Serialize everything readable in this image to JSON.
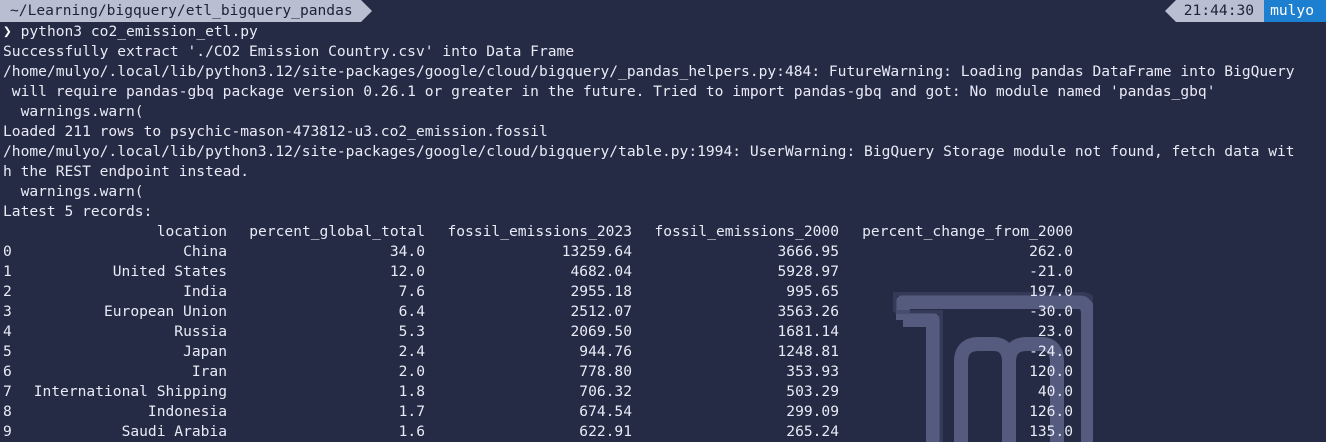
{
  "prompt": {
    "path": "~/Learning/bigquery/etl_bigquery_pandas",
    "time": "21:44:30",
    "user": "mulyo",
    "symbol": "❯",
    "command": "python3 co2_emission_etl.py"
  },
  "output": {
    "lines": [
      "Successfully extract './CO2 Emission Country.csv' into Data Frame",
      "/home/mulyo/.local/lib/python3.12/site-packages/google/cloud/bigquery/_pandas_helpers.py:484: FutureWarning: Loading pandas DataFrame into BigQuery",
      " will require pandas-gbq package version 0.26.1 or greater in the future. Tried to import pandas-gbq and got: No module named 'pandas_gbq'",
      "  warnings.warn(",
      "Loaded 211 rows to psychic-mason-473812-u3.co2_emission.fossil",
      "/home/mulyo/.local/lib/python3.12/site-packages/google/cloud/bigquery/table.py:1994: UserWarning: BigQuery Storage module not found, fetch data wit",
      "h the REST endpoint instead.",
      "  warnings.warn(",
      "Latest 5 records:"
    ]
  },
  "table": {
    "headers": [
      "location",
      "percent_global_total",
      "fossil_emissions_2023",
      "fossil_emissions_2000",
      "percent_change_from_2000"
    ],
    "rows": [
      [
        "0",
        "China",
        "34.0",
        "13259.64",
        "3666.95",
        "262.0"
      ],
      [
        "1",
        "United States",
        "12.0",
        "4682.04",
        "5928.97",
        "-21.0"
      ],
      [
        "2",
        "India",
        "7.6",
        "2955.18",
        "995.65",
        "197.0"
      ],
      [
        "3",
        "European Union",
        "6.4",
        "2512.07",
        "3563.26",
        "-30.0"
      ],
      [
        "4",
        "Russia",
        "5.3",
        "2069.50",
        "1681.14",
        "23.0"
      ],
      [
        "5",
        "Japan",
        "2.4",
        "944.76",
        "1248.81",
        "-24.0"
      ],
      [
        "6",
        "Iran",
        "2.0",
        "778.80",
        "353.93",
        "120.0"
      ],
      [
        "7",
        "International Shipping",
        "1.8",
        "706.32",
        "503.29",
        "40.0"
      ],
      [
        "8",
        "Indonesia",
        "1.7",
        "674.54",
        "299.09",
        "126.0"
      ],
      [
        "9",
        "Saudi Arabia",
        "1.6",
        "622.91",
        "265.24",
        "135.0"
      ]
    ]
  },
  "colors": {
    "background": "#252a45",
    "text": "#e8ebf5",
    "prompt_segment": "#b9bfd1",
    "user_segment": "#1d7fd0",
    "watermark": "#5d6488"
  },
  "icons": {
    "watermark": "linux-mint-logo-icon"
  }
}
